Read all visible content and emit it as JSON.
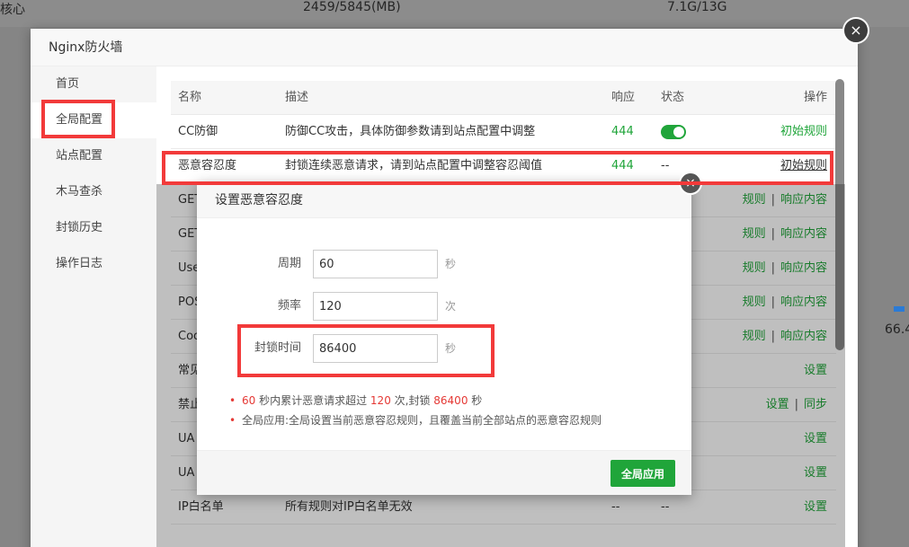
{
  "background": {
    "left_text": "核心",
    "mid_text": "2459/5845(MB)",
    "right_text": "7.1G/13G",
    "side_value": "66.4"
  },
  "layer": {
    "title": "Nginx防火墙",
    "close_icon": "×"
  },
  "sidebar": {
    "items": [
      {
        "label": "首页"
      },
      {
        "label": "全局配置"
      },
      {
        "label": "站点配置"
      },
      {
        "label": "木马查杀"
      },
      {
        "label": "封锁历史"
      },
      {
        "label": "操作日志"
      }
    ]
  },
  "table": {
    "headers": {
      "name": "名称",
      "desc": "描述",
      "resp": "响应",
      "status": "状态",
      "op": "操作"
    },
    "rows": [
      {
        "name": "CC防御",
        "desc": "防御CC攻击，具体防御参数请到站点配置中调整",
        "resp": "444",
        "status": "toggle-on",
        "op": "初始规则"
      },
      {
        "name": "恶意容忍度",
        "desc": "封锁连续恶意请求，请到站点配置中调整容忍阈值",
        "resp": "444",
        "status": "--",
        "op": "初始规则"
      },
      {
        "name": "GET",
        "op1": "规则",
        "op2": "响应内容"
      },
      {
        "name": "GET",
        "op1": "规则",
        "op2": "响应内容"
      },
      {
        "name": "Use",
        "op1": "规则",
        "op2": "响应内容"
      },
      {
        "name": "POS",
        "op1": "规则",
        "op2": "响应内容"
      },
      {
        "name": "Coo",
        "op1": "规则",
        "op2": "响应内容"
      },
      {
        "name": "常见",
        "op": "设置"
      },
      {
        "name": "禁止",
        "op1": "设置",
        "op2": "同步"
      },
      {
        "name": "UA",
        "op": "设置"
      },
      {
        "name": "UA",
        "op": "设置"
      },
      {
        "name": "IP白名单",
        "desc": "所有规则对IP白名单无效",
        "resp": "--",
        "status": "--",
        "op": "设置"
      }
    ],
    "separator": "|"
  },
  "dialog": {
    "title": "设置恶意容忍度",
    "close_icon": "×",
    "fields": [
      {
        "label": "周期",
        "value": "60",
        "unit": "秒"
      },
      {
        "label": "频率",
        "value": "120",
        "unit": "次"
      },
      {
        "label": "封锁时间",
        "value": "86400",
        "unit": "秒"
      }
    ],
    "tip1": {
      "cycle": "60",
      "t1": " 秒内累计恶意请求超过 ",
      "freq": "120",
      "t2": " 次,封锁 ",
      "block": "86400",
      "t3": " 秒"
    },
    "tip2": "全局应用:全局设置当前恶意容忍规则，且覆盖当前全部站点的恶意容忍规则",
    "apply_label": "全局应用"
  },
  "colors": {
    "accent": "#20a53a",
    "highlight": "#f23a3a",
    "warning": "#e53935"
  }
}
